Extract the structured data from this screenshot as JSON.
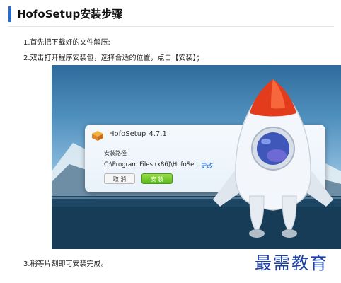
{
  "heading": "HofoSetup安装步骤",
  "steps": [
    "1.首先把下载好的文件解压;",
    "2.双击打开程序安装包，选择合适的位置，点击【安装】；",
    "3.稍等片刻即可安装完成。"
  ],
  "installer": {
    "app_name": "HofoSetup",
    "version": "4.7.1",
    "path_label": "安装路径",
    "path_value": "C:\\Program Files (x86)\\HofoSe...",
    "change_link": "更改",
    "cancel_label": "取 消",
    "install_label": "安 装",
    "icon": "package-icon"
  },
  "watermark": "最需教育",
  "colors": {
    "accent": "#2a6bc9",
    "install_button": "#6cc22b",
    "link": "#2b6fd6",
    "watermark": "#1c3fa8"
  }
}
